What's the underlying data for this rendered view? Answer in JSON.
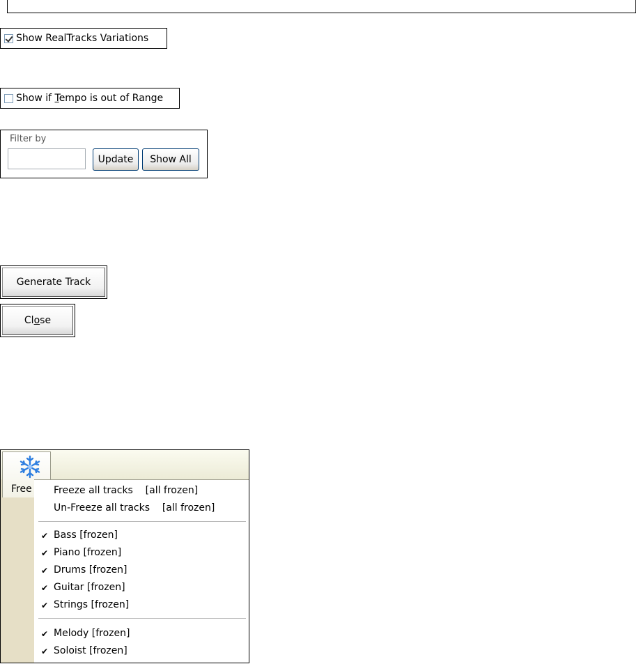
{
  "show_variations": {
    "label": "Show RealTracks Variations",
    "checked": true
  },
  "show_tempo": {
    "label_pre": "Show if ",
    "label_accel": "T",
    "label_post": "empo is out of Range",
    "checked": false
  },
  "filter": {
    "legend": "Filter by",
    "value": "",
    "update_label": "Update",
    "show_all_label": "Show All"
  },
  "generate_button": {
    "label": "Generate Track"
  },
  "close_button": {
    "label_pre": "Cl",
    "label_accel": "o",
    "label_post": "se"
  },
  "freeze_menu": {
    "button_label": "Free",
    "icon": "snowflake-icon",
    "items": [
      {
        "label": "Freeze all tracks    [all frozen]"
      },
      {
        "label": "Un-Freeze all tracks    [all frozen]"
      }
    ],
    "tracks_group1": [
      {
        "label": "Bass [frozen]",
        "checked": true
      },
      {
        "label": "Piano [frozen]",
        "checked": true
      },
      {
        "label": "Drums [frozen]",
        "checked": true
      },
      {
        "label": "Guitar [frozen]",
        "checked": true
      },
      {
        "label": "Strings [frozen]",
        "checked": true
      }
    ],
    "tracks_group2": [
      {
        "label": "Melody [frozen]",
        "checked": true
      },
      {
        "label": "Soloist [frozen]",
        "checked": true
      }
    ],
    "check_glyph": "✔"
  }
}
